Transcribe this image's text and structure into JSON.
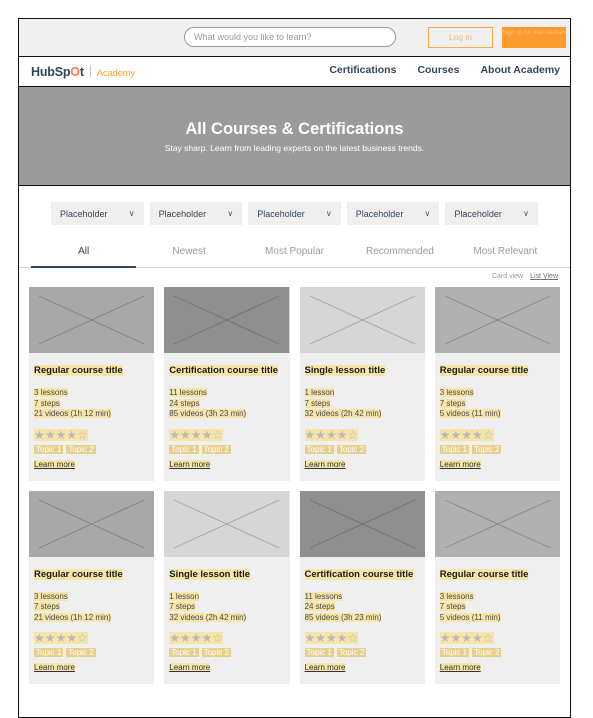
{
  "utility_bar": {
    "search_placeholder": "What would you like to learn?",
    "search_value": "",
    "login_label": "Log in",
    "signup_label": "Sign up for free courses"
  },
  "brand": {
    "part1": "HubSp",
    "part2": "O",
    "part3": "t",
    "academy": "Academy"
  },
  "nav": {
    "links": [
      {
        "label": "Certifications"
      },
      {
        "label": "Courses"
      },
      {
        "label": "About Academy"
      }
    ]
  },
  "hero": {
    "title": "All Courses & Certifications",
    "subtitle": "Stay sharp. Learn from leading experts on the latest business trends."
  },
  "filters": [
    {
      "label": "Placeholder",
      "chevron": "chevron-down-icon"
    },
    {
      "label": "Placeholder",
      "chevron": "chevron-down-icon"
    },
    {
      "label": "Placeholder",
      "chevron": "chevron-down-icon"
    },
    {
      "label": "Placeholder",
      "chevron": "chevron-down-icon"
    },
    {
      "label": "Placeholder",
      "chevron": "chevron-down-icon"
    }
  ],
  "tabs": [
    {
      "label": "All",
      "active": true
    },
    {
      "label": "Newest",
      "active": false
    },
    {
      "label": "Most Popular",
      "active": false
    },
    {
      "label": "Recommended",
      "active": false
    },
    {
      "label": "Most Relevant",
      "active": false
    }
  ],
  "view_switch": {
    "card_view": "Card view",
    "list_view": "List View"
  },
  "cards": [
    {
      "title": "Regular course title",
      "lessons": "3 lessons",
      "steps": "7 steps",
      "videos": "21 videos (1h 12 min)",
      "stars": "★★★★☆",
      "rating": 4,
      "topic1": "Topic 1",
      "topic2": "Topic 2",
      "learn_more": "Learn more",
      "thumb_color": "#a8a8a8"
    },
    {
      "title": "Certification course title",
      "lessons": "11 lessons",
      "steps": "24 steps",
      "videos": "85 videos (3h 23 min)",
      "stars": "★★★★☆",
      "rating": 4,
      "topic1": "Topic 1",
      "topic2": "Topic 2",
      "learn_more": "Learn more",
      "thumb_color": "#8f8f8f"
    },
    {
      "title": "Single lesson title",
      "lessons": "1 lesson",
      "steps": "7 steps",
      "videos": "32 videos (2h 42 min)",
      "stars": "★★★★☆",
      "rating": 4,
      "topic1": "Topic 1",
      "topic2": "Topic 2",
      "learn_more": "Learn more",
      "thumb_color": "#d6d6d6"
    },
    {
      "title": "Regular course title",
      "lessons": "3 lessons",
      "steps": "7 steps",
      "videos": "5 videos (11 min)",
      "stars": "★★★★☆",
      "rating": 4,
      "topic1": "Topic 1",
      "topic2": "Topic 2",
      "learn_more": "Learn more",
      "thumb_color": "#b0b0b0"
    },
    {
      "title": "Regular course title",
      "lessons": "3 lessons",
      "steps": "7 steps",
      "videos": "21 videos (1h 12 min)",
      "stars": "★★★★☆",
      "rating": 4,
      "topic1": "Topic 1",
      "topic2": "Topic 2",
      "learn_more": "Learn more",
      "thumb_color": "#a8a8a8"
    },
    {
      "title": "Single lesson title",
      "lessons": "1 lesson",
      "steps": "7 steps",
      "videos": "32 videos (2h 42 min)",
      "stars": "★★★★☆",
      "rating": 4,
      "topic1": "Topic 1",
      "topic2": "Topic 2",
      "learn_more": "Learn more",
      "thumb_color": "#d6d6d6"
    },
    {
      "title": "Certification course title",
      "lessons": "11 lessons",
      "steps": "24 steps",
      "videos": "85 videos (3h 23 min)",
      "stars": "★★★★☆",
      "rating": 4,
      "topic1": "Topic 1",
      "topic2": "Topic 2",
      "learn_more": "Learn more",
      "thumb_color": "#8f8f8f"
    },
    {
      "title": "Regular course title",
      "lessons": "3 lessons",
      "steps": "7 steps",
      "videos": "5 videos (11 min)",
      "stars": "★★★★☆",
      "rating": 4,
      "topic1": "Topic 1",
      "topic2": "Topic 2",
      "learn_more": "Learn more",
      "thumb_color": "#b0b0b0"
    }
  ],
  "colors": {
    "brand_orange": "#ff7a59",
    "accent_orange": "#ff9a2e",
    "academy_orange": "#f5a623",
    "highlight_yellow": "#f6e4a8",
    "hero_gray": "#9b9b9b",
    "nav_dark": "#33475b"
  }
}
